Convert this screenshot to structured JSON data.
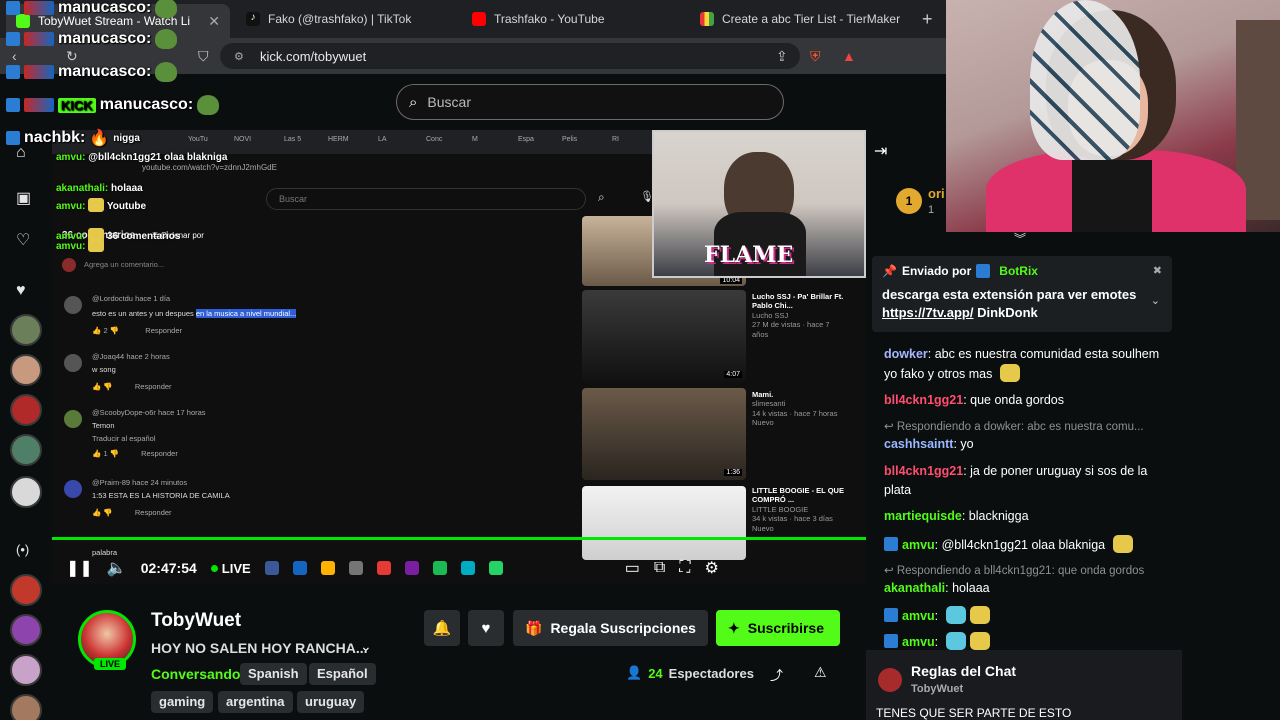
{
  "browser": {
    "tabs": [
      {
        "label": "TobyWuet Stream - Watch Li",
        "color": "#53fc18"
      },
      {
        "label": "Fako (@trashfako) | TikTok",
        "color": "#111111"
      },
      {
        "label": "Trashfako - YouTube",
        "color": "#ff0000"
      },
      {
        "label": "Create a abc Tier List - TierMaker",
        "color": "#444444"
      }
    ],
    "url": "kick.com/tobywuet",
    "new_tab": "+"
  },
  "site": {
    "search_placeholder": "Buscar"
  },
  "video": {
    "yt_tabs": [
      "YouTu",
      "NOVI",
      "Las 5",
      "HERM",
      "LA",
      "Conc",
      "M",
      "Espa",
      "Pelis",
      "RI"
    ],
    "yt_url": "youtube.com/watch?v=zdnnJ2mhGdE",
    "yt_search": "Buscar",
    "comments_count": "36 comentarios",
    "sort_label": "Ordenar por",
    "add_comment": "Agrega un comentario...",
    "comments": [
      {
        "user": "@Lordoctdu",
        "time": "hace 1 día",
        "text_a": "esto es un antes y un despues ",
        "text_b": "en la musica a nivel mundial...",
        "likes": "2",
        "reply": "Responder"
      },
      {
        "user": "@Joaq44",
        "time": "hace 2 horas",
        "text_a": "w song",
        "text_b": "",
        "likes": "",
        "reply": "Responder"
      },
      {
        "user": "@ScoobyDope-o6r",
        "time": "hace 17 horas",
        "text_a": "Temon",
        "text_b": "Traducir al español",
        "likes": "1",
        "reply": "Responder"
      },
      {
        "user": "@Praim-89",
        "time": "hace 24 minutos",
        "text_a": "1:53 ESTA ES LA HISTORIA DE CAMILA",
        "text_b": "",
        "likes": "",
        "reply": "Responder"
      }
    ],
    "last_comment_fragment": "palabra",
    "related": [
      {
        "title": "Lucho SSJ - Pa' Brillar Ft. Pablo Chi...",
        "channel": "Lucho SSJ",
        "meta": "27 M de vistas · hace 7 años",
        "duration": "4:07"
      },
      {
        "title": "Mami.",
        "channel": "slimesanti",
        "meta": "14 k vistas · hace 7 horas",
        "badge": "Nuevo",
        "duration": "1:36"
      },
      {
        "title": "LITTLE BOOGIE - EL QUE COMPRÓ ...",
        "channel": "LITTLE BOOGIE",
        "meta": "34 k vistas · hace 3 días",
        "badge": "Nuevo"
      }
    ],
    "top_duration": "10:04",
    "flame_text": "FLAME",
    "timecode": "02:47:54",
    "live_label": "LIVE"
  },
  "channel": {
    "name": "TobyWuet",
    "title": "HOY NO SALEN HOY RANCHA...",
    "category": "Conversando",
    "tags": [
      "Spanish",
      "Español",
      "gaming",
      "argentina",
      "uruguay"
    ],
    "live_badge": "LIVE",
    "gift_label": "Regala Suscripciones",
    "subscribe_label": "Suscribirse",
    "viewers": "24",
    "viewers_label": "Espectadores"
  },
  "chat": {
    "leaderboard_rank": "1",
    "leaderboard_name": "ori",
    "leaderboard_sub": "1",
    "pinned_by_label": "Enviado por",
    "pinned_by_user": "BotRix",
    "pinned_msg_a": "descarga esta extensión para ver emotes ",
    "pinned_msg_link": "https://7tv.app/",
    "pinned_msg_b": " DinkDonk",
    "messages": [
      {
        "user": "dowker",
        "color": "#a7b7ff",
        "text": "abc es nuestra comunidad esta soulhem yo fako y otros mas"
      },
      {
        "user": "bll4ckn1gg21",
        "color": "#ff4d6d",
        "text": "que onda gordos"
      },
      {
        "reply": "Respondiendo a dowker: abc es nuestra comu..."
      },
      {
        "user": "cashhsaintt",
        "color": "#9ab8ff",
        "text": "yo"
      },
      {
        "user": "bll4ckn1gg21",
        "color": "#ff4d6d",
        "text": "ja de poner uruguay si sos de la plata"
      },
      {
        "user": "martiequisde",
        "color": "#53fc18",
        "text": "blacknigga"
      },
      {
        "user": "amvu",
        "color": "#53fc18",
        "text": "@bll4ckn1gg21 olaa blakniga"
      },
      {
        "reply": "Respondiendo a bll4ckn1gg21: que onda gordos"
      },
      {
        "user": "akanathali",
        "color": "#53fc18",
        "text": "holaaa"
      },
      {
        "user": "amvu",
        "color": "#53fc18",
        "text": ""
      },
      {
        "user": "amvu",
        "color": "#53fc18",
        "text": ""
      }
    ],
    "rules_title": "Reglas del Chat",
    "rules_owner": "TobyWuet",
    "rules_text": "TENES QUE SER PARTE DE ESTO"
  },
  "overlay": {
    "lines": [
      {
        "user": "manucasco:"
      },
      {
        "user": "manucasco:"
      },
      {
        "user": "manucasco:"
      },
      {
        "user": "manucasco:"
      },
      {
        "user": "nachbk:",
        "text": "nigga"
      }
    ],
    "small_lines": [
      {
        "user": "amvu:",
        "text": "@bll4ckn1gg21 olaa blakniga"
      },
      {
        "user": "akanathali:",
        "text": "holaaa"
      },
      {
        "user": "amvu:",
        "text": "Youtube"
      },
      {
        "user": "amvu:",
        "text": "36 comentarios"
      },
      {
        "user": "amvu:",
        "text": ""
      }
    ],
    "kick_logo": "KICK"
  }
}
